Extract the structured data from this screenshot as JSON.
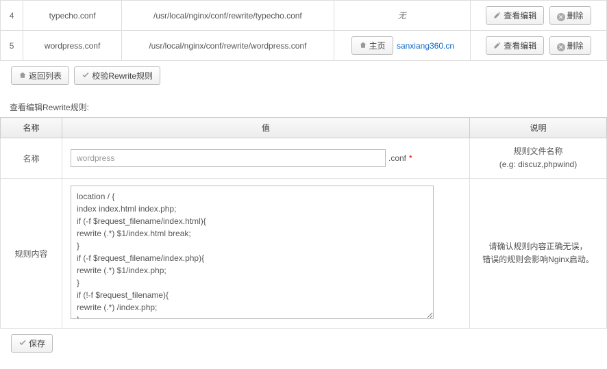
{
  "rows": [
    {
      "idx": "4",
      "file": "typecho.conf",
      "path": "/usr/local/nginx/conf/rewrite/typecho.conf",
      "site_none": "无",
      "site_link": "",
      "home_btn": ""
    },
    {
      "idx": "5",
      "file": "wordpress.conf",
      "path": "/usr/local/nginx/conf/rewrite/wordpress.conf",
      "site_none": "",
      "site_link": "sanxiang360.cn",
      "home_btn": "主页"
    }
  ],
  "row_actions": {
    "view_edit": "查看编辑",
    "delete": "删除"
  },
  "toolbar": {
    "back": "返回列表",
    "validate": "校验Rewrite规则"
  },
  "section_label": "查看编辑Rewrite规则:",
  "form_headers": {
    "name": "名称",
    "value": "值",
    "desc": "说明"
  },
  "form": {
    "name_label": "名称",
    "name_value": "wordpress",
    "name_suffix": ".conf",
    "name_desc_title": "规则文件名称",
    "name_desc_hint": "(e.g: discuz,phpwind)",
    "content_label": "规则内容",
    "content_value": "location / {\nindex index.html index.php;\nif (-f $request_filename/index.html){\nrewrite (.*) $1/index.html break;\n}\nif (-f $request_filename/index.php){\nrewrite (.*) $1/index.php;\n}\nif (!-f $request_filename){\nrewrite (.*) /index.php;\n}\n}\nrewrite /wp-admin$ $scheme://$host$uri/ permanent;",
    "content_desc_l1": "请确认规则内容正确无误，",
    "content_desc_l2": "错误的规则会影响Nginx启动。"
  },
  "save_label": "保存"
}
